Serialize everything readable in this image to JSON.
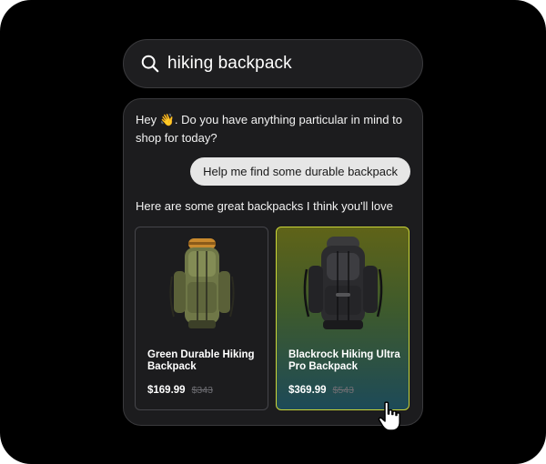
{
  "search": {
    "value": "hiking backpack",
    "icon": "search-icon"
  },
  "chat": {
    "greeting_prefix": "Hey ",
    "greeting_emoji": "👋",
    "greeting_suffix": ". Do you have anything particular in mind to shop for today?",
    "user_message": "Help me find some durable backpack",
    "bot_reply": "Here are some great backpacks I think you'll love",
    "products": [
      {
        "title": "Green Durable Hiking Backpack",
        "price": "$169.99",
        "old_price": "$343"
      },
      {
        "title": "Blackrock Hiking Ultra Pro Backpack",
        "price": "$369.99",
        "old_price": "$543"
      }
    ]
  },
  "colors": {
    "background": "#000000",
    "surface": "#1c1c1e",
    "selected_border": "#c9d438",
    "selected_gradient_top": "#5f6318",
    "selected_gradient_bottom": "#1d4a58"
  }
}
